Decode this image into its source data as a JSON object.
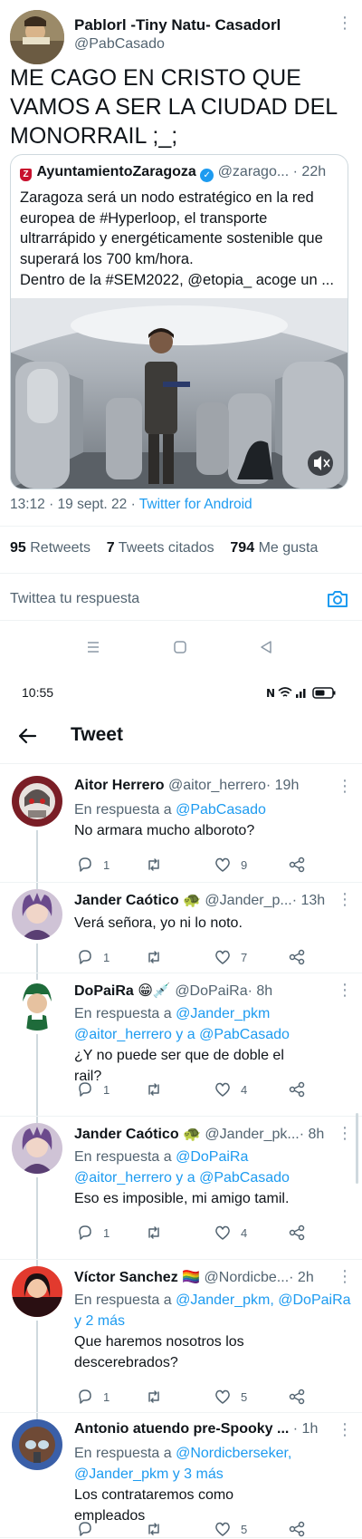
{
  "main_tweet": {
    "author_name": "Pablorl -Tiny Natu- Casadorl",
    "author_handle": "@PabCasado",
    "text": "ME CAGO EN CRISTO QUE VAMOS A SER LA CIUDAD DEL MONORRAIL ;_;",
    "quoted": {
      "author_name": "AyuntamientoZaragoza",
      "author_handle": "@zarago...",
      "time": "22h",
      "logo_letter": "Z",
      "text": "Zaragoza será un nodo estratégico en la red europea de #Hyperloop, el transporte ultrarrápido y energéticamente sostenible que superará los 700 km/hora.",
      "text2": "Dentro de la #SEM2022, @etopia_ acoge un ..."
    },
    "timestamp": "13:12 · 19 sept. 22 · ",
    "client": "Twitter for Android",
    "stats": {
      "retweets_count": "95",
      "retweets_label": "Retweets",
      "quotes_count": "7",
      "quotes_label": "Tweets citados",
      "likes_count": "794",
      "likes_label": "Me gusta"
    },
    "reply_placeholder": "Twittea tu respuesta"
  },
  "status_bar": {
    "time": "10:55"
  },
  "header": {
    "title": "Tweet"
  },
  "replies": [
    {
      "name": "Aitor Herrero",
      "emoji": "",
      "handle": "@aitor_herrero",
      "time": "· 19h",
      "reply_to_prefix": "En respuesta a ",
      "reply_to_line1": "@PabCasado",
      "reply_to_line2": "",
      "text": "No armara mucho alboroto?",
      "replies_count": "1",
      "retweets_count": "",
      "likes_count": "9"
    },
    {
      "name": "Jander Caótico",
      "emoji": "🐢",
      "handle": "@Jander_p...",
      "time": "· 13h",
      "reply_to_prefix": "",
      "reply_to_line1": "",
      "reply_to_line2": "",
      "text": "Verá señora, yo ni lo noto.",
      "replies_count": "1",
      "retweets_count": "",
      "likes_count": "7"
    },
    {
      "name": "DoPaiRa",
      "emoji": "😁💉",
      "handle": "@DoPaiRa",
      "time": "· 8h",
      "reply_to_prefix": "En respuesta a ",
      "reply_to_line1": "@Jander_pkm",
      "reply_to_line2": "@aitor_herrero y a @PabCasado",
      "text": "¿Y no puede ser que de doble el rail?",
      "replies_count": "1",
      "retweets_count": "",
      "likes_count": "4"
    },
    {
      "name": "Jander Caótico",
      "emoji": "🐢",
      "handle": "@Jander_pk...",
      "time": "· 8h",
      "reply_to_prefix": "En respuesta a ",
      "reply_to_line1": "@DoPaiRa",
      "reply_to_line2": "@aitor_herrero y a @PabCasado",
      "text": "Eso es imposible, mi amigo tamil.",
      "replies_count": "1",
      "retweets_count": "",
      "likes_count": "4"
    },
    {
      "name": "Víctor Sanchez",
      "emoji": "🏳️‍🌈",
      "handle": "@Nordicbe...",
      "time": "· 2h",
      "reply_to_prefix": "En respuesta a ",
      "reply_to_line1": "@Jander_pkm, @DoPaiRa",
      "reply_to_line2": "y 2 más",
      "text": "Que haremos nosotros los descerebrados?",
      "replies_count": "1",
      "retweets_count": "",
      "likes_count": "5"
    },
    {
      "name": "Antonio atuendo pre-Spooky ...",
      "emoji": "",
      "handle": "",
      "time": "· 1h",
      "reply_to_prefix": "En respuesta a ",
      "reply_to_line1": "@Nordicberseker,",
      "reply_to_line2": "@Jander_pkm y 3 más",
      "text": "Los contrataremos como empleados",
      "replies_count": "",
      "retweets_count": "",
      "likes_count": "5"
    }
  ]
}
